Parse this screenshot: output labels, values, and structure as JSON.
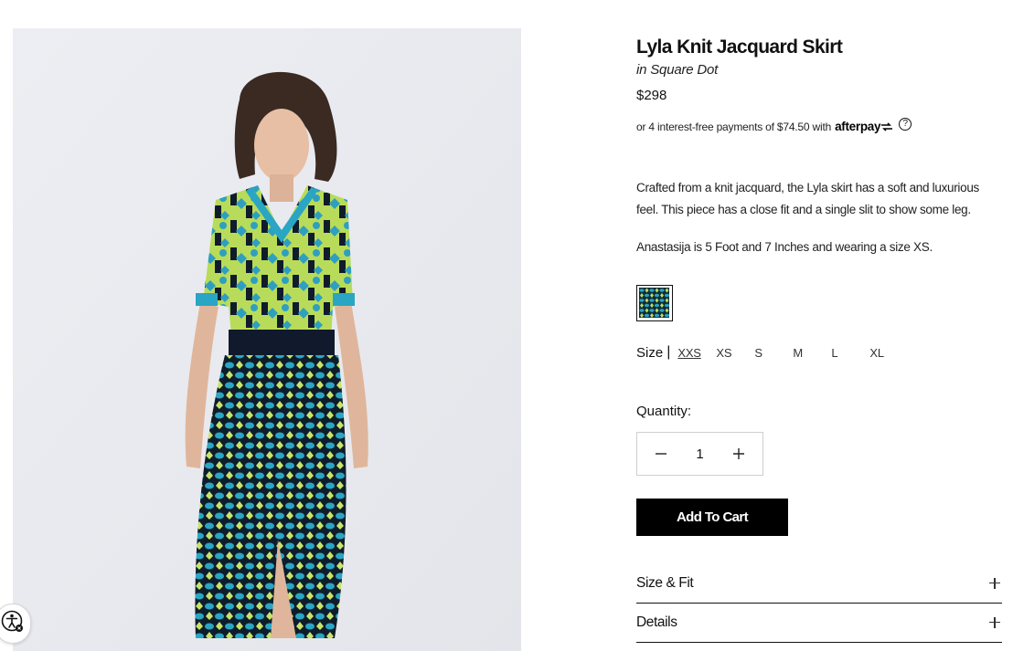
{
  "product": {
    "title": "Lyla Knit Jacquard Skirt",
    "variant": "in Square Dot",
    "price": "$298",
    "afterpay_text": "or 4 interest-free payments of $74.50 with",
    "afterpay_brand": "afterpay",
    "help_glyph": "?",
    "description": "Crafted from a knit jacquard, the Lyla skirt has a soft and luxurious feel. This piece has a close fit and a single slit to show some leg.",
    "model_info": "Anastasija is 5 Foot and 7 Inches and wearing a size XS."
  },
  "swatch": {
    "name": "Square Dot",
    "colors": {
      "base": "#0f2c3a",
      "teal": "#2aa2bf",
      "lime": "#b9e05a"
    }
  },
  "sizes": {
    "label": "Size",
    "separator": "|",
    "options": [
      "XXS",
      "XS",
      "S",
      "M",
      "L",
      "XL"
    ],
    "selected": "XXS"
  },
  "quantity": {
    "label": "Quantity:",
    "value": "1"
  },
  "cart": {
    "label": "Add To Cart"
  },
  "accordions": [
    {
      "label": "Size & Fit"
    },
    {
      "label": "Details"
    }
  ],
  "icons": {
    "minus": "minus-icon",
    "plus": "plus-icon",
    "accessibility": "accessibility-icon",
    "help": "help-circle-icon"
  }
}
